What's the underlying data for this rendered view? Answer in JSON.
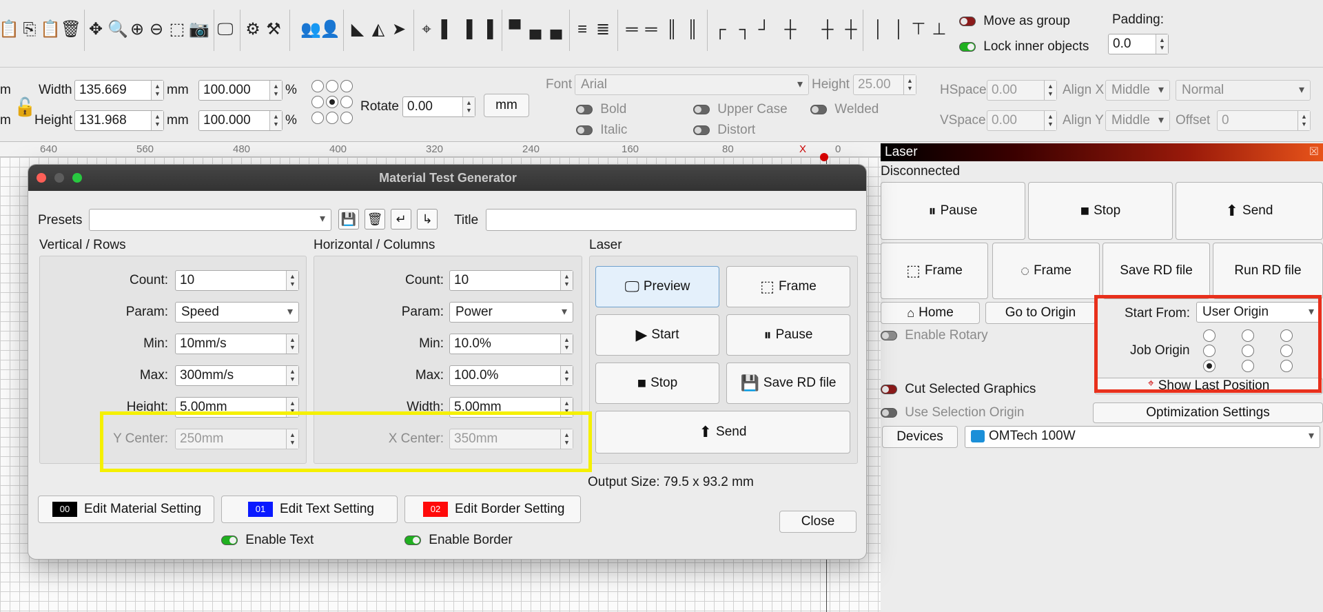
{
  "toolbar": {
    "move_as_group": "Move as group",
    "lock_inner": "Lock inner objects",
    "padding_label": "Padding:",
    "padding_value": "0.0",
    "icons": [
      "paste-icon",
      "copy-icon",
      "clipboard-icon",
      "delete-icon",
      "move-icon",
      "zoom-window-icon",
      "zoom-in-icon",
      "zoom-out-icon",
      "select-rect-icon",
      "camera-icon",
      "monitor-icon",
      "settings-icon",
      "tools-icon",
      "group-icon",
      "user-icon",
      "mirror-h-icon",
      "mirror-v-icon",
      "send-icon",
      "target-icon",
      "align-left-icon",
      "align-center-icon",
      "align-right-icon",
      "align-top-icon",
      "align-middle-icon",
      "align-bottom-icon",
      "distribute-icon",
      "distribute2-icon",
      "spacing-h-icon",
      "spacing-v-icon",
      "spacing-c-icon",
      "corner-tl-icon",
      "corner-tr-icon",
      "path-icon",
      "path2-icon",
      "path3-icon",
      "dist-h-icon",
      "dist-v-icon",
      "dist-c-icon"
    ]
  },
  "props": {
    "pos_unit_top": "m",
    "pos_unit_bottom": "m",
    "width_label": "Width",
    "width_value": "135.669",
    "height_label": "Height",
    "height_value": "131.968",
    "unit_mm": "mm",
    "width_pct": "100.000",
    "height_pct": "100.000",
    "pct": "%",
    "rotate_label": "Rotate",
    "rotate_value": "0.00",
    "mm_button": "mm",
    "font_label": "Font",
    "font_value": "Arial",
    "height2_label": "Height",
    "height2_value": "25.00",
    "bold": "Bold",
    "italic": "Italic",
    "upper_case": "Upper Case",
    "distort": "Distort",
    "welded": "Welded",
    "hspace_label": "HSpace",
    "hspace_value": "0.00",
    "vspace_label": "VSpace",
    "vspace_value": "0.00",
    "alignx_label": "Align X",
    "alignx_value": "Middle",
    "aligny_label": "Align Y",
    "aligny_value": "Middle",
    "normal_value": "Normal",
    "offset_label": "Offset",
    "offset_value": "0"
  },
  "ruler": {
    "labels": [
      "640",
      "560",
      "480",
      "400",
      "320",
      "240",
      "160",
      "80",
      "0"
    ],
    "x_marker": "X"
  },
  "laser": {
    "title": "Laser",
    "status": "Disconnected",
    "pause": "Pause",
    "stop": "Stop",
    "send": "Send",
    "frame1": "Frame",
    "frame2": "Frame",
    "save_rd": "Save RD file",
    "run_rd": "Run RD file",
    "home": "Home",
    "go_origin": "Go to Origin",
    "start_from_label": "Start From:",
    "start_from_value": "User Origin",
    "enable_rotary": "Enable Rotary",
    "job_origin_label": "Job Origin",
    "show_last": "Show Last Position",
    "cut_selected": "Cut Selected Graphics",
    "use_selection": "Use Selection Origin",
    "optimization": "Optimization Settings",
    "devices": "Devices",
    "device_value": "OMTech 100W",
    "highlight_color": "#e8301c"
  },
  "dialog": {
    "title": "Material Test Generator",
    "presets_label": "Presets",
    "presets_value": "",
    "title_label": "Title",
    "title_value": "",
    "rows_title": "Vertical / Rows",
    "cols_title": "Horizontal / Columns",
    "laser_title": "Laser",
    "rows": {
      "count_label": "Count:",
      "count": "10",
      "param_label": "Param:",
      "param": "Speed",
      "min_label": "Min:",
      "min": "10mm/s",
      "max_label": "Max:",
      "max": "300mm/s",
      "size_label": "Height:",
      "size": "5.00mm",
      "center_label": "Y Center:",
      "center": "250mm"
    },
    "cols": {
      "count_label": "Count:",
      "count": "10",
      "param_label": "Param:",
      "param": "Power",
      "min_label": "Min:",
      "min": "10.0%",
      "max_label": "Max:",
      "max": "100.0%",
      "size_label": "Width:",
      "size": "5.00mm",
      "center_label": "X Center:",
      "center": "350mm"
    },
    "preview": "Preview",
    "frame": "Frame",
    "start": "Start",
    "pause": "Pause",
    "stop": "Stop",
    "save_rd": "Save RD file",
    "send": "Send",
    "output_size": "Output Size: 79.5 x 93.2 mm",
    "edit_material": "Edit Material Setting",
    "edit_text": "Edit Text Setting",
    "edit_border": "Edit Border Setting",
    "swatch_material": "00",
    "swatch_text": "01",
    "swatch_border": "02",
    "swatch_colors": {
      "material": "#000000",
      "text": "#0a1aff",
      "border": "#ff0a0a"
    },
    "enable_text": "Enable Text",
    "enable_border": "Enable Border",
    "close": "Close",
    "highlight_color": "#f5f000"
  }
}
